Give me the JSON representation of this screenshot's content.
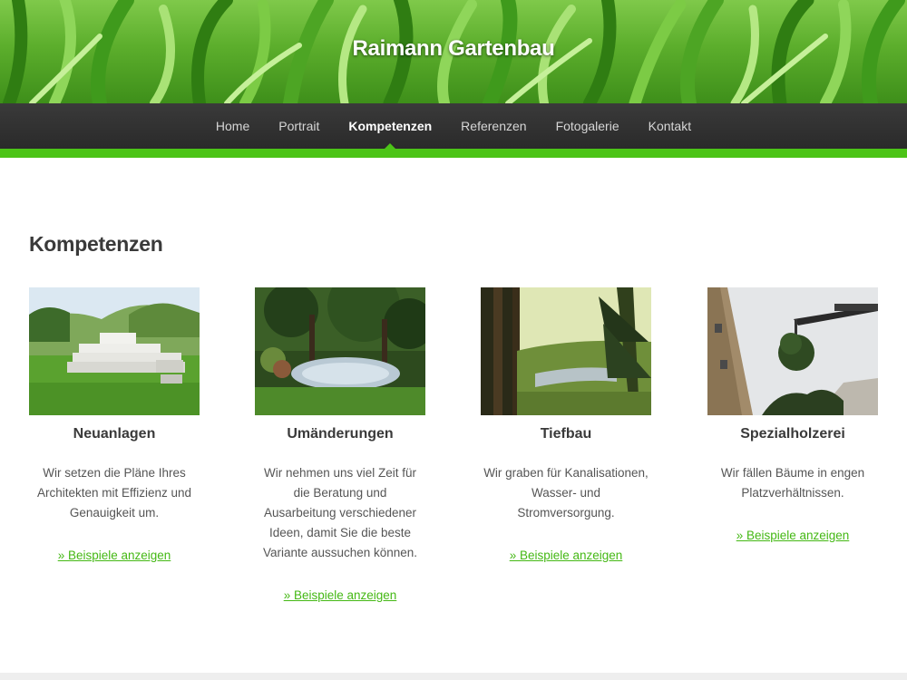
{
  "site": {
    "title": "Raimann Gartenbau"
  },
  "nav": {
    "items": [
      {
        "label": "Home"
      },
      {
        "label": "Portrait"
      },
      {
        "label": "Kompetenzen",
        "active": true
      },
      {
        "label": "Referenzen"
      },
      {
        "label": "Fotogalerie"
      },
      {
        "label": "Kontakt"
      }
    ]
  },
  "main": {
    "heading": "Kompetenzen",
    "cards": [
      {
        "title": "Neuanlagen",
        "text": "Wir setzen die Pläne Ihres Architekten mit Effizienz und Genauigkeit um.",
        "link": "» Beispiele anzeigen"
      },
      {
        "title": "Umänderungen",
        "text": "Wir nehmen uns viel Zeit für die Beratung und Ausarbeitung verschiedener Ideen, damit Sie die beste Variante aussuchen können.",
        "link": "» Beispiele anzeigen"
      },
      {
        "title": "Tiefbau",
        "text": "Wir graben für Kanalisationen, Wasser- und Stromversorgung.",
        "link": "» Beispiele anzeigen"
      },
      {
        "title": "Spezialholzerei",
        "text": "Wir fällen Bäume in engen Platzverhältnissen.",
        "link": "» Beispiele anzeigen"
      }
    ]
  },
  "colors": {
    "accent": "#4cc417",
    "nav_bg": "#2f2f2f",
    "link": "#44b814"
  }
}
